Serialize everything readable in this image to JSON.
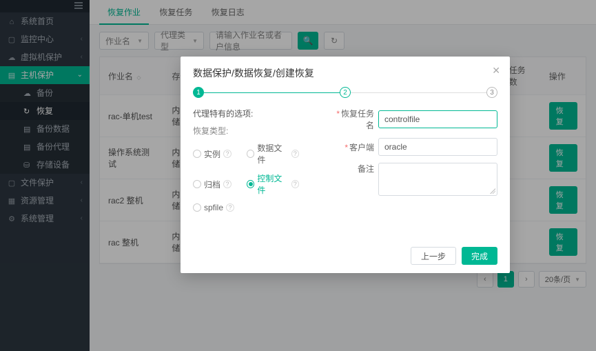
{
  "sidebar": {
    "items": [
      {
        "icon": "⌂",
        "label": "系统首页",
        "chev": ""
      },
      {
        "icon": "▢",
        "label": "监控中心",
        "chev": "‹"
      },
      {
        "icon": "☁",
        "label": "虚拟机保护",
        "chev": "‹"
      },
      {
        "icon": "▤",
        "label": "主机保护",
        "chev": "⌄",
        "active": true
      },
      {
        "icon": "▢",
        "label": "文件保护",
        "chev": "‹"
      },
      {
        "icon": "▦",
        "label": "资源管理",
        "chev": "‹"
      },
      {
        "icon": "⚙",
        "label": "系统管理",
        "chev": "‹"
      }
    ],
    "subitems": [
      {
        "icon": "☁",
        "label": "备份"
      },
      {
        "icon": "↻",
        "label": "恢复",
        "active": true
      },
      {
        "icon": "▤",
        "label": "备份数据"
      },
      {
        "icon": "▤",
        "label": "备份代理"
      },
      {
        "icon": "⛁",
        "label": "存储设备"
      }
    ]
  },
  "tabs": [
    {
      "label": "恢复作业",
      "active": true
    },
    {
      "label": "恢复任务"
    },
    {
      "label": "恢复日志"
    }
  ],
  "toolbar": {
    "select1": "作业名",
    "select2": "代理类型",
    "search_placeholder": "请输入作业名或者户信息"
  },
  "table": {
    "headers": [
      "作业名",
      "存储名",
      "任务数",
      "操作"
    ],
    "rows": [
      {
        "name": "rac-单机test",
        "storage": "内置存储",
        "action": "恢复"
      },
      {
        "name": "操作系统测试",
        "storage": "内置存储",
        "action": "恢复"
      },
      {
        "name": "rac2 整机",
        "storage": "内置存储",
        "action": "恢复"
      },
      {
        "name": "rac 整机",
        "storage": "内置存储",
        "action": "恢复"
      }
    ]
  },
  "pagination": {
    "page": "1",
    "size": "20条/页"
  },
  "modal": {
    "title": "数据保护/数据恢复/创建恢复",
    "steps": [
      "1",
      "2",
      "3"
    ],
    "left_title": "代理特有的选项:",
    "type_label": "恢复类型:",
    "options": [
      {
        "label": "实例",
        "sel": false
      },
      {
        "label": "数据文件",
        "sel": false
      },
      {
        "label": "归档",
        "sel": false
      },
      {
        "label": "控制文件",
        "sel": true
      },
      {
        "label": "spfile",
        "sel": false
      }
    ],
    "form": {
      "task_label": "恢复任务名",
      "task_value": "controlfile",
      "client_label": "客户端",
      "client_value": "oracle",
      "remark_label": "备注"
    },
    "buttons": {
      "prev": "上一步",
      "done": "完成"
    }
  }
}
